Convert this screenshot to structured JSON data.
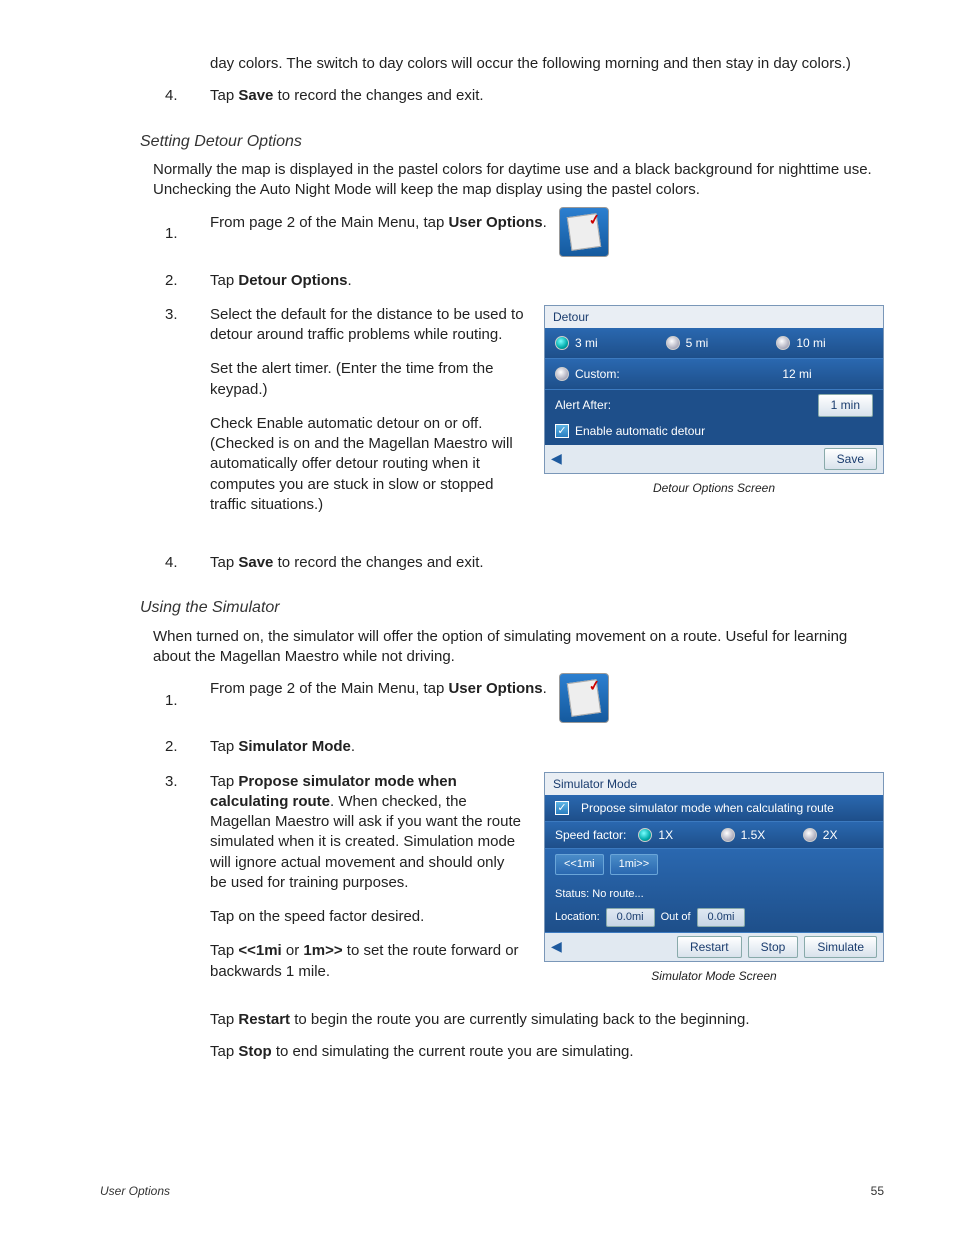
{
  "intro_continuation": "day colors.  The switch to day colors will occur the following morning and then stay in day colors.)",
  "intro_step4_pre": "Tap ",
  "intro_step4_bold": "Save",
  "intro_step4_post": " to record the changes and exit.",
  "section_detour_title": "Setting Detour Options",
  "section_detour_body": "Normally the map is displayed in the pastel colors for daytime use and a black background for nighttime use.  Unchecking the Auto Night Mode will keep the map display using the pastel colors.",
  "detour_steps": {
    "s1_pre": "From page 2 of the Main Menu, tap ",
    "s1_bold": "User Options",
    "s1_post": ".",
    "s2_pre": "Tap ",
    "s2_bold": "Detour Options",
    "s2_post": ".",
    "s3a": "Select the default for the distance to be used to detour around traffic problems while routing.",
    "s3b": "Set the alert timer.  (Enter the time from the keypad.)",
    "s3c": "Check Enable automatic detour on or off.  (Checked is on and the Magellan Maestro will automatically offer detour routing when it computes you are stuck in slow or stopped traffic situations.)",
    "s4_pre": "Tap ",
    "s4_bold": "Save",
    "s4_post": " to record the changes and exit."
  },
  "detour_screen": {
    "title": "Detour",
    "opt_3mi": "3 mi",
    "opt_5mi": "5 mi",
    "opt_10mi": "10 mi",
    "opt_custom": "Custom:",
    "custom_val": "12 mi",
    "alert_label": "Alert After:",
    "alert_val": "1 min",
    "enable_label": "Enable automatic detour",
    "save": "Save",
    "caption": "Detour Options Screen"
  },
  "section_sim_title": "Using the Simulator",
  "section_sim_body": "When turned on, the simulator will offer the option of simulating movement on a route.  Useful for learning about the Magellan Maestro while not driving.",
  "sim_steps": {
    "s1_pre": "From page 2 of the Main Menu, tap ",
    "s1_bold": "User Options",
    "s1_post": ".",
    "s2_pre": "Tap ",
    "s2_bold": "Simulator Mode",
    "s2_post": ".",
    "s3_pre": "Tap ",
    "s3_bold": "Propose simulator mode when calculating route",
    "s3_post": ".  When checked, the Magellan Maestro will ask if you want the route simulated when it is created.  Simulation mode will ignore actual movement and should only be used for training purposes.",
    "s3b": "Tap on the speed factor desired.",
    "s3c_pre": "Tap ",
    "s3c_b1": "<<1mi",
    "s3c_mid": " or ",
    "s3c_b2": "1m>>",
    "s3c_post": " to set the route forward or backwards 1 mile.",
    "s3d_pre": "Tap ",
    "s3d_bold": "Restart",
    "s3d_post": " to begin the route you are currently simulating back to the beginning.",
    "s3e_pre": "Tap  ",
    "s3e_bold": "Stop",
    "s3e_post": " to end simulating the current route you are simulating."
  },
  "sim_screen": {
    "title": "Simulator Mode",
    "propose": "Propose simulator mode when calculating route",
    "speed_label": "Speed factor:",
    "sp_1x": "1X",
    "sp_15x": "1.5X",
    "sp_2x": "2X",
    "back1": "<<1mi",
    "fwd1": "1mi>>",
    "status": "Status: No route...",
    "loc_label": "Location:",
    "loc_v1": "0.0mi",
    "loc_mid": "Out of",
    "loc_v2": "0.0mi",
    "restart": "Restart",
    "stop": "Stop",
    "simulate": "Simulate",
    "caption": "Simulator Mode Screen"
  },
  "footer_left": "User Options",
  "footer_right": "55"
}
